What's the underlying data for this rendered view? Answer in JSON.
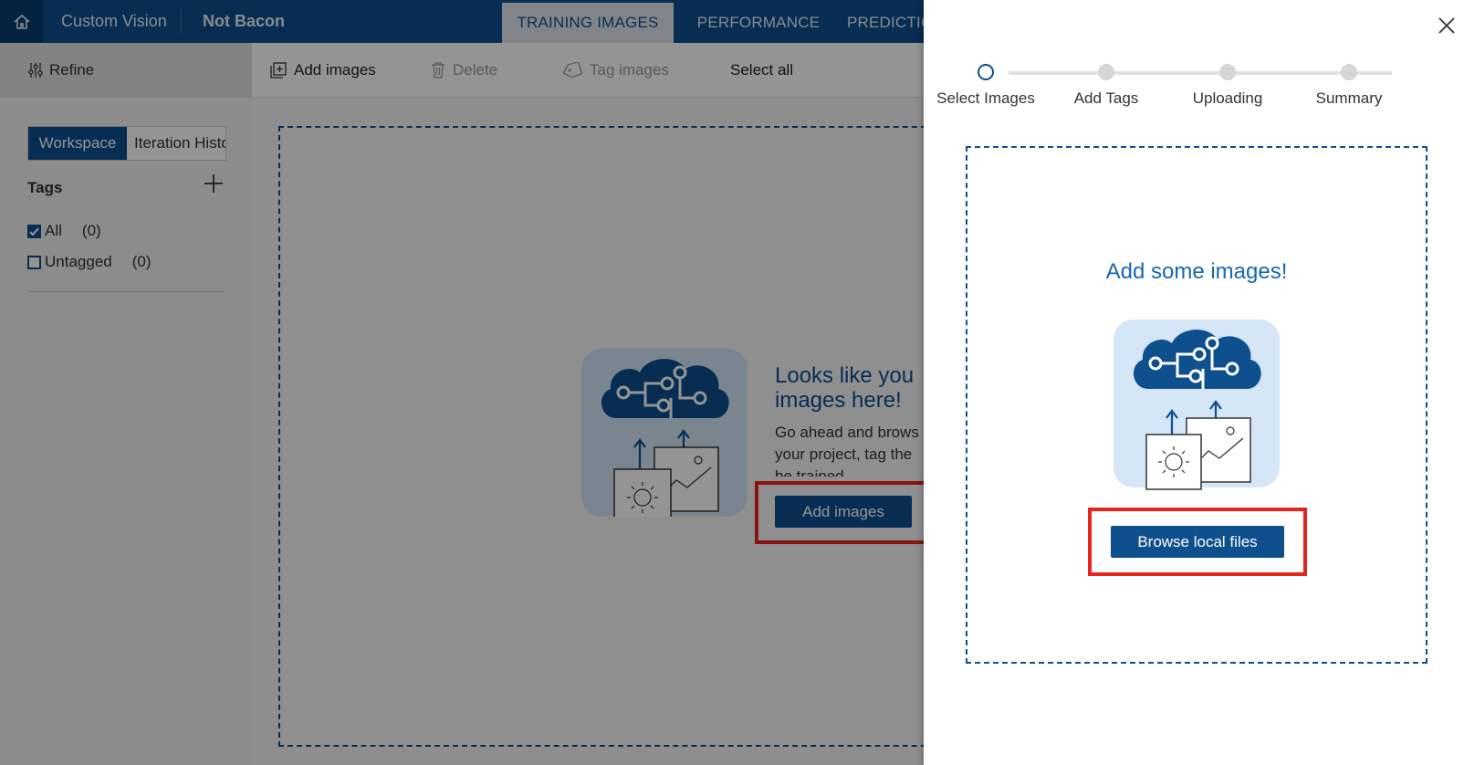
{
  "topbar": {
    "app_title": "Custom Vision",
    "project_name": "Not Bacon",
    "tabs": [
      {
        "label": "TRAINING IMAGES",
        "active": true
      },
      {
        "label": "PERFORMANCE",
        "active": false
      },
      {
        "label": "PREDICTIC",
        "active": false
      }
    ]
  },
  "sidebar": {
    "refine_label": "Refine",
    "workspace_label": "Workspace",
    "iteration_history_label": "Iteration History",
    "tags_title": "Tags",
    "tags": [
      {
        "label": "All",
        "count": "(0)",
        "checked": true
      },
      {
        "label": "Untagged",
        "count": "(0)",
        "checked": false
      }
    ]
  },
  "toolbar": {
    "add_images_label": "Add images",
    "delete_label": "Delete",
    "tag_images_label": "Tag images",
    "select_all_label": "Select all"
  },
  "main": {
    "heading_line1": "Looks like you",
    "heading_line2": "images here!",
    "body_line1": "Go ahead and brows",
    "body_line2": "your project, tag the",
    "body_line3": "be trained.",
    "add_images_button": "Add images"
  },
  "panel": {
    "steps": [
      "Select Images",
      "Add Tags",
      "Uploading",
      "Summary"
    ],
    "current_step": 0,
    "heading": "Add some images!",
    "browse_button": "Browse local files"
  },
  "colors": {
    "brand": "#0e4f8d",
    "highlight": "#e8231a",
    "link_blue": "#1767b4"
  },
  "icons": [
    "home-icon",
    "refine-icon",
    "plus-icon",
    "add-images-icon",
    "delete-icon",
    "tag-icon",
    "close-icon",
    "brain-cloud-icon",
    "upload-arrow-icon",
    "photo-icon"
  ]
}
